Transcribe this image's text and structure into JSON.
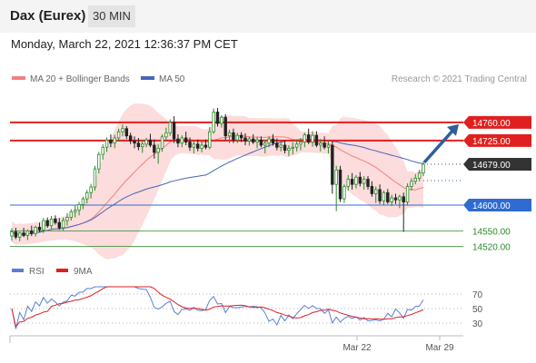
{
  "instrument": "Dax (Eurex)",
  "timeframe": "30 MIN",
  "datetime": "Monday, March 22, 2021 12:36:37 PM CET",
  "copyright": "Research © 2021 Trading Central",
  "colors": {
    "resistance": "#e02020",
    "support": "#2f6bd0",
    "green_support": "#2a8a2a",
    "price_label": "#333333",
    "bollinger_fill": "#fbd6d6",
    "ma20": "#f08080",
    "ma50": "#4466bb",
    "arrow": "#2f5d9e",
    "rsi": "#5b7ed6",
    "rsi_ma": "#e02020"
  },
  "legend": {
    "ma20_label": "MA 20 + Bollinger Bands",
    "ma50_label": "MA 50"
  },
  "rsi_legend": {
    "rsi_label": "RSI",
    "ma_label": "9MA"
  },
  "levels": [
    {
      "id": "resistance-2",
      "value": 14760,
      "label": "14760.00",
      "kind": "resistance"
    },
    {
      "id": "resistance-1",
      "value": 14725,
      "label": "14725.00",
      "kind": "resistance"
    },
    {
      "id": "last-price",
      "value": 14679,
      "label": "14679.00",
      "kind": "price"
    },
    {
      "id": "pivot",
      "value": 14600,
      "label": "14600.00",
      "kind": "pivot"
    },
    {
      "id": "support-1",
      "value": 14550,
      "label": "14550.00",
      "kind": "support"
    },
    {
      "id": "support-2",
      "value": 14520,
      "label": "14520.00",
      "kind": "support"
    }
  ],
  "rsi_levels": [
    "70",
    "50",
    "30"
  ],
  "x_axis_labels": [
    "Mar 22",
    "Mar 29"
  ],
  "chart_data": {
    "type": "candlestick",
    "title": "Dax (Eurex)",
    "timeframe": "30 MIN",
    "y_range": [
      14505,
      14795
    ],
    "levels": [
      14760,
      14725,
      14679,
      14600,
      14550,
      14520
    ],
    "last_price": 14679,
    "forecast_target": 14760,
    "candles": [
      [
        14540,
        14555,
        14531,
        14548
      ],
      [
        14548,
        14556,
        14534,
        14538
      ],
      [
        14538,
        14548,
        14530,
        14546
      ],
      [
        14546,
        14556,
        14538,
        14541
      ],
      [
        14541,
        14553,
        14532,
        14550
      ],
      [
        14550,
        14560,
        14540,
        14545
      ],
      [
        14545,
        14560,
        14539,
        14557
      ],
      [
        14557,
        14566,
        14548,
        14552
      ],
      [
        14552,
        14575,
        14546,
        14570
      ],
      [
        14570,
        14576,
        14556,
        14560
      ],
      [
        14560,
        14579,
        14554,
        14573
      ],
      [
        14573,
        14580,
        14562,
        14566
      ],
      [
        14566,
        14575,
        14552,
        14556
      ],
      [
        14556,
        14576,
        14550,
        14570
      ],
      [
        14570,
        14584,
        14560,
        14576
      ],
      [
        14576,
        14592,
        14570,
        14587
      ],
      [
        14587,
        14599,
        14576,
        14590
      ],
      [
        14590,
        14606,
        14580,
        14601
      ],
      [
        14601,
        14616,
        14592,
        14612
      ],
      [
        14612,
        14629,
        14603,
        14624
      ],
      [
        14624,
        14641,
        14613,
        14635
      ],
      [
        14635,
        14676,
        14628,
        14670
      ],
      [
        14670,
        14703,
        14661,
        14698
      ],
      [
        14698,
        14718,
        14688,
        14712
      ],
      [
        14712,
        14731,
        14703,
        14726
      ],
      [
        14726,
        14737,
        14712,
        14720
      ],
      [
        14720,
        14736,
        14710,
        14730
      ],
      [
        14730,
        14748,
        14723,
        14742
      ],
      [
        14742,
        14756,
        14733,
        14748
      ],
      [
        14748,
        14753,
        14728,
        14734
      ],
      [
        14734,
        14740,
        14718,
        14724
      ],
      [
        14724,
        14733,
        14710,
        14720
      ],
      [
        14720,
        14730,
        14706,
        14713
      ],
      [
        14713,
        14725,
        14701,
        14718
      ],
      [
        14718,
        14730,
        14712,
        14726
      ],
      [
        14726,
        14738,
        14712,
        14716
      ],
      [
        14716,
        14727,
        14690,
        14702
      ],
      [
        14702,
        14718,
        14680,
        14710
      ],
      [
        14710,
        14737,
        14703,
        14732
      ],
      [
        14732,
        14750,
        14724,
        14740
      ],
      [
        14740,
        14766,
        14734,
        14760
      ],
      [
        14760,
        14772,
        14720,
        14728
      ],
      [
        14728,
        14737,
        14712,
        14720
      ],
      [
        14720,
        14735,
        14712,
        14730
      ],
      [
        14730,
        14742,
        14716,
        14722
      ],
      [
        14722,
        14731,
        14705,
        14712
      ],
      [
        14712,
        14724,
        14700,
        14718
      ],
      [
        14718,
        14727,
        14704,
        14710
      ],
      [
        14710,
        14723,
        14702,
        14716
      ],
      [
        14716,
        14727,
        14708,
        14712
      ],
      [
        14712,
        14751,
        14708,
        14742
      ],
      [
        14742,
        14787,
        14738,
        14780
      ],
      [
        14780,
        14788,
        14752,
        14758
      ],
      [
        14758,
        14774,
        14750,
        14770
      ],
      [
        14770,
        14776,
        14726,
        14734
      ],
      [
        14734,
        14746,
        14720,
        14740
      ],
      [
        14740,
        14748,
        14720,
        14726
      ],
      [
        14726,
        14740,
        14720,
        14735
      ],
      [
        14735,
        14741,
        14722,
        14730
      ],
      [
        14730,
        14739,
        14716,
        14724
      ],
      [
        14724,
        14733,
        14715,
        14728
      ],
      [
        14728,
        14737,
        14718,
        14722
      ],
      [
        14722,
        14732,
        14710,
        14726
      ],
      [
        14726,
        14733,
        14712,
        14716
      ],
      [
        14716,
        14726,
        14700,
        14720
      ],
      [
        14720,
        14733,
        14712,
        14728
      ],
      [
        14728,
        14737,
        14715,
        14720
      ],
      [
        14720,
        14729,
        14706,
        14712
      ],
      [
        14712,
        14724,
        14704,
        14716
      ],
      [
        14716,
        14725,
        14700,
        14706
      ],
      [
        14706,
        14716,
        14695,
        14710
      ],
      [
        14710,
        14722,
        14698,
        14712
      ],
      [
        14712,
        14726,
        14704,
        14718
      ],
      [
        14718,
        14730,
        14706,
        14722
      ],
      [
        14722,
        14740,
        14712,
        14736
      ],
      [
        14736,
        14748,
        14718,
        14722
      ],
      [
        14722,
        14743,
        14713,
        14735
      ],
      [
        14735,
        14743,
        14712,
        14716
      ],
      [
        14716,
        14728,
        14704,
        14720
      ],
      [
        14720,
        14733,
        14708,
        14712
      ],
      [
        14712,
        14724,
        14700,
        14716
      ],
      [
        14716,
        14723,
        14622,
        14640
      ],
      [
        14640,
        14676,
        14588,
        14668
      ],
      [
        14668,
        14676,
        14606,
        14612
      ],
      [
        14612,
        14640,
        14604,
        14636
      ],
      [
        14636,
        14658,
        14628,
        14650
      ],
      [
        14650,
        14662,
        14630,
        14640
      ],
      [
        14640,
        14658,
        14632,
        14654
      ],
      [
        14654,
        14664,
        14636,
        14642
      ],
      [
        14642,
        14656,
        14630,
        14650
      ],
      [
        14650,
        14656,
        14630,
        14636
      ],
      [
        14636,
        14646,
        14616,
        14622
      ],
      [
        14622,
        14636,
        14604,
        14630
      ],
      [
        14630,
        14640,
        14602,
        14608
      ],
      [
        14608,
        14628,
        14600,
        14624
      ],
      [
        14624,
        14631,
        14602,
        14606
      ],
      [
        14606,
        14620,
        14598,
        14614
      ],
      [
        14614,
        14622,
        14602,
        14610
      ],
      [
        14610,
        14620,
        14594,
        14616
      ],
      [
        14616,
        14624,
        14548,
        14606
      ],
      [
        14606,
        14642,
        14600,
        14636
      ],
      [
        14636,
        14652,
        14628,
        14646
      ],
      [
        14646,
        14660,
        14640,
        14652
      ],
      [
        14652,
        14668,
        14646,
        14662
      ],
      [
        14662,
        14684,
        14656,
        14679
      ]
    ],
    "forecast": {
      "from": 14679,
      "to": 14760,
      "direction": "up"
    },
    "rsi": {
      "levels": [
        70,
        50,
        30
      ],
      "rsi_start": 45,
      "rsi_end": 75,
      "ma_end": 65
    },
    "x_labels": [
      "Mar 22",
      "Mar 29"
    ]
  }
}
